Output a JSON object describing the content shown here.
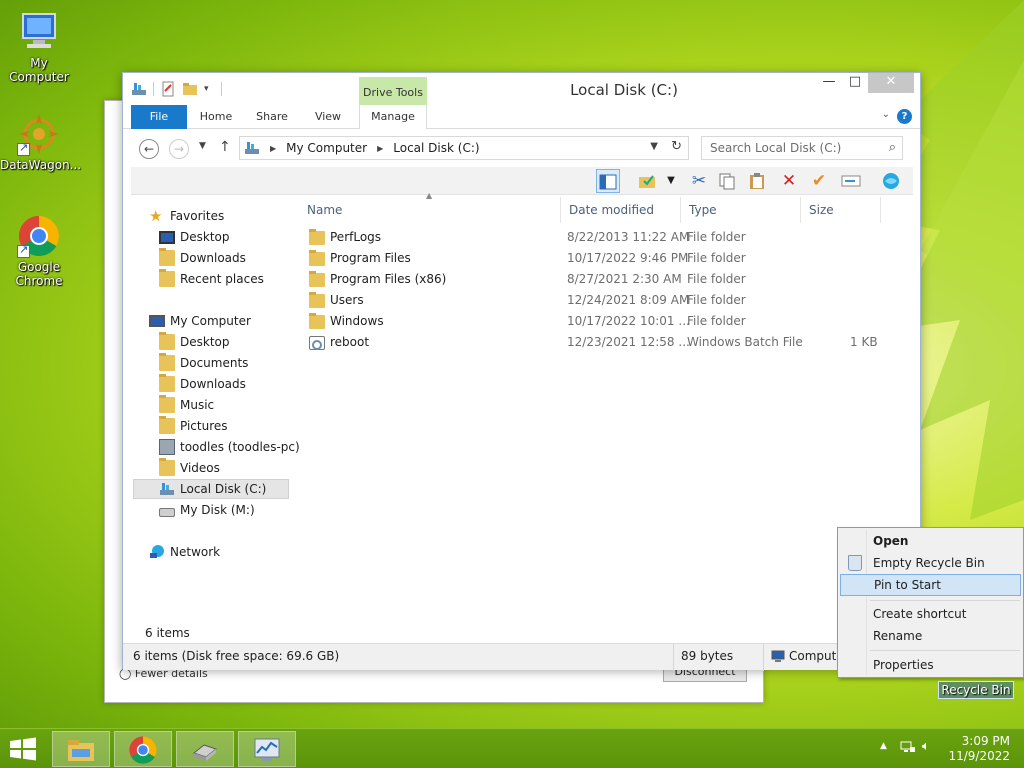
{
  "desktop": {
    "icons": [
      {
        "label": "My Computer"
      },
      {
        "label": "DataWagon..."
      },
      {
        "label": "Google Chrome"
      }
    ],
    "recycle_bin_label": "Recycle Bin"
  },
  "background_window": {
    "bottom_text": "Fewer details",
    "button_label": "Disconnect"
  },
  "window": {
    "title": "Local Disk (C:)",
    "contextual_tab_group": "Drive Tools",
    "tabs": [
      "File",
      "Home",
      "Share",
      "View",
      "Manage"
    ],
    "controls": {
      "minimize": "—",
      "maximize": "□",
      "close": "✕"
    },
    "address": {
      "crumbs": [
        "My Computer",
        "Local Disk (C:)"
      ]
    },
    "search": {
      "placeholder": "Search Local Disk (C:)"
    },
    "nav": {
      "favorites_header": "Favorites",
      "favorites": [
        "Desktop",
        "Downloads",
        "Recent places"
      ],
      "computer_header": "My Computer",
      "computer": [
        "Desktop",
        "Documents",
        "Downloads",
        "Music",
        "Pictures",
        "toodles (toodles-pc)",
        "Videos",
        "Local Disk (C:)",
        "My Disk (M:)"
      ],
      "network": "Network",
      "selected": "Local Disk (C:)"
    },
    "columns": [
      "Name",
      "Date modified",
      "Type",
      "Size"
    ],
    "files": [
      {
        "name": "PerfLogs",
        "date": "8/22/2013 11:22 AM",
        "type": "File folder",
        "size": "",
        "icon": "folder-icon"
      },
      {
        "name": "Program Files",
        "date": "10/17/2022 9:46 PM",
        "type": "File folder",
        "size": "",
        "icon": "folder-icon"
      },
      {
        "name": "Program Files (x86)",
        "date": "8/27/2021 2:30 AM",
        "type": "File folder",
        "size": "",
        "icon": "folder-icon"
      },
      {
        "name": "Users",
        "date": "12/24/2021 8:09 AM",
        "type": "File folder",
        "size": "",
        "icon": "folder-icon"
      },
      {
        "name": "Windows",
        "date": "10/17/2022 10:01 ...",
        "type": "File folder",
        "size": "",
        "icon": "folder-icon"
      },
      {
        "name": "reboot",
        "date": "12/23/2021 12:58 ...",
        "type": "Windows Batch File",
        "size": "1 KB",
        "icon": "batch-file-icon"
      }
    ],
    "item_count": "6 items",
    "status": {
      "summary": "6 items (Disk free space: 69.6 GB)",
      "size": "89 bytes",
      "location": "Computer"
    }
  },
  "context_menu": {
    "items": [
      "Open",
      "Empty Recycle Bin",
      "Pin to Start",
      "Create shortcut",
      "Rename",
      "Properties"
    ],
    "highlighted": "Pin to Start"
  },
  "taskbar": {
    "apps": [
      "file-explorer",
      "google-chrome",
      "network-drive",
      "system-monitor"
    ],
    "time": "3:09 PM",
    "date": "11/9/2022"
  }
}
